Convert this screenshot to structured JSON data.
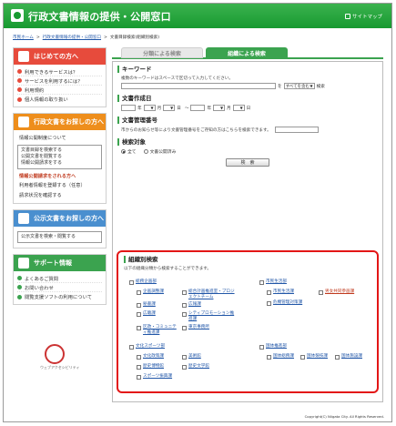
{
  "header": {
    "title": "行政文書情報の提供・公開窓口",
    "sitemap": "サイトマップ"
  },
  "breadcrumb": {
    "home": "市民ホーム",
    "parent": "行政文書情報の提供・公開窓口",
    "current": "文書目録検索(組織別検索)"
  },
  "sidebar": {
    "start": {
      "title": "はじめての方へ",
      "items": [
        "利用できるサービスは？",
        "サービスを利用するには？",
        "利用規約",
        "個人情報の取り扱い"
      ]
    },
    "find": {
      "title": "行政文書をお探しの方へ",
      "item1": "情報公開制度について",
      "box_lines": [
        "文書目録を検索する",
        "公開文書を閲覧する",
        "情報公開請求をする"
      ],
      "sub_title": "情報公開請求をされる方へ",
      "item2": "利用者情報を登録する（任意）",
      "item3": "請求状況を確認する"
    },
    "public": {
      "title": "公示文書をお探しの方へ",
      "item": "公示文書を検索・閲覧する"
    },
    "support": {
      "title": "サポート情報",
      "items": [
        "よくあるご質問",
        "お問い合わせ",
        "閲覧支援ソフトの利用について"
      ]
    },
    "seal_text": "ウェブアクセシビリティ"
  },
  "tabs": {
    "category": "分類による検索",
    "organization": "組織による検索"
  },
  "keyword": {
    "title": "キーワード",
    "desc": "複数のキーワードはスペースで区切って入力してください。",
    "wo": "を",
    "match": "すべてを含む",
    "suffix": "検索"
  },
  "date": {
    "title": "文書作成日",
    "year": "年",
    "month": "月",
    "day": "日",
    "range": "～"
  },
  "docno": {
    "title": "文書管理番号",
    "desc": "市からのお知らせ等により文書管理番号をご存知の方はこちらを検索できます。"
  },
  "target": {
    "title": "検索対象",
    "all": "全て",
    "public": "文書公開済み",
    "search_btn": "検　索"
  },
  "org": {
    "title": "組織別検索",
    "desc": "以下の組織分類から検索することができます。",
    "groups": [
      {
        "name": "総務企画部",
        "items": [
          "企画調整課",
          "総合計画推進室・プロジェクトチーム",
          "秘書課",
          "広報課",
          "広聴課",
          "シティプロモーション推進課",
          "区政・コミュニティ推進課",
          "東京事務所"
        ]
      },
      {
        "name": "市民生活部",
        "items": [
          "市民生活課",
          "男女共同参画課",
          "危機管理対策課"
        ]
      },
      {
        "name": "文化スポーツ部",
        "items": [
          "文化政策課",
          "美術館",
          "歴史博物館",
          "歴史文学館",
          "スポーツ振興課"
        ]
      },
      {
        "name": "国体推進部",
        "items": [
          "国体総務課",
          "国体競技課",
          "国体施設課"
        ]
      }
    ]
  },
  "footer": "Copyright(C) Niigata City. All Rights Reserved."
}
